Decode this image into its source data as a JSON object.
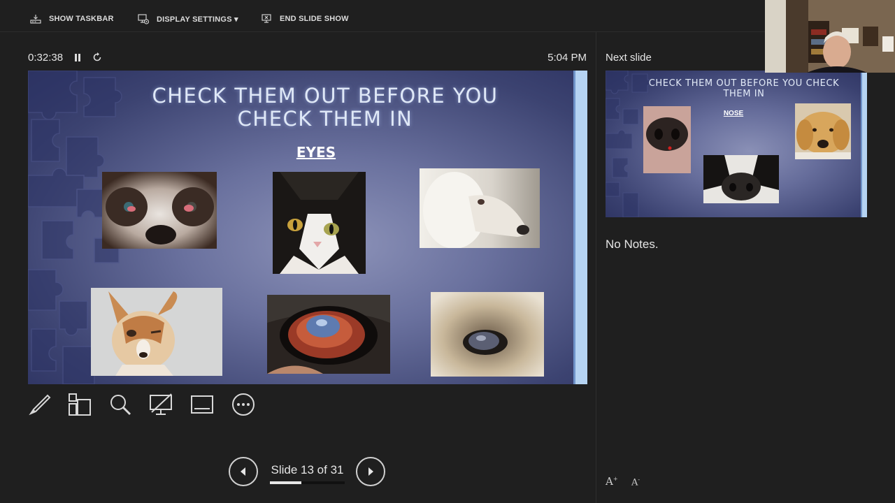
{
  "toolbar": {
    "show_taskbar": "SHOW TASKBAR",
    "display_settings": "DISPLAY SETTINGS ▾",
    "end_slide_show": "END SLIDE SHOW"
  },
  "timer": {
    "elapsed": "0:32:38",
    "clock": "5:04 PM"
  },
  "current_slide": {
    "title": "CHECK THEM OUT BEFORE YOU CHECK THEM IN",
    "subtitle": "EYES"
  },
  "navigation": {
    "slide_label": "Slide 13 of 31",
    "current": 13,
    "total": 31
  },
  "next_slide": {
    "label": "Next slide",
    "title": "CHECK THEM OUT BEFORE YOU CHECK THEM IN",
    "subtitle": "NOSE"
  },
  "notes": {
    "text": "No Notes."
  },
  "icons": {
    "tools": [
      "pen-icon",
      "slides-grid-icon",
      "zoom-icon",
      "black-screen-icon",
      "subtitles-icon",
      "more-options-icon"
    ]
  },
  "colors": {
    "background": "#1f1f1f",
    "slide_accent": "#b5d3f2",
    "text": "#e6e6e6"
  }
}
